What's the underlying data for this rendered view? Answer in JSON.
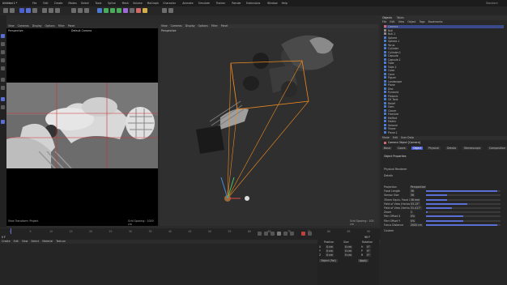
{
  "app": {
    "window_title": "Untitled 1 *",
    "menus": [
      "File",
      "Edit",
      "Create",
      "Modes",
      "Select",
      "Tools",
      "Spline",
      "Mesh",
      "Volume",
      "MoGraph",
      "Character",
      "Animate",
      "Simulate",
      "Tracker",
      "Render",
      "Extensions",
      "Window",
      "Help"
    ],
    "layout_label": "Standard"
  },
  "left_viewport": {
    "menu": [
      "View",
      "Cameras",
      "Display",
      "Options",
      "Filter",
      "Panel"
    ],
    "title": "Perspective",
    "camera": "Default Camera",
    "footer_left": "View Transform: Project",
    "footer_right": "Grid Spacing : 1000 cm"
  },
  "main_viewport": {
    "menu": [
      "View",
      "Cameras",
      "Display",
      "Options",
      "Filter",
      "Panel"
    ],
    "title": "Perspective",
    "footer_right": "Grid Spacing : 100 cm"
  },
  "timeline": {
    "frames": [
      "0",
      "5",
      "10",
      "15",
      "20",
      "25",
      "30",
      "35",
      "40",
      "45",
      "50",
      "55",
      "60",
      "65",
      "70",
      "75",
      "80",
      "85",
      "90"
    ],
    "current_frame": "0 F",
    "end_frame": "90 F"
  },
  "bottom_panel": {
    "menu": [
      "Create",
      "Edit",
      "View",
      "Select",
      "Material",
      "Texture"
    ],
    "coordinates": {
      "headers": [
        "Position",
        "Size",
        "Rotation"
      ],
      "rows": [
        [
          "X",
          "0 cm",
          "0 cm",
          "H",
          "0°"
        ],
        [
          "Y",
          "0 cm",
          "0 cm",
          "P",
          "0°"
        ],
        [
          "Z",
          "0 cm",
          "0 cm",
          "B",
          "0°"
        ]
      ],
      "mode": "Object (Rel)",
      "apply": "Apply"
    }
  },
  "object_manager": {
    "tabs": [
      "Objects",
      "Takes"
    ],
    "menu": [
      "File",
      "Edit",
      "View",
      "Object",
      "Tags",
      "Bookmarks"
    ],
    "items": [
      "Camera",
      "Null",
      "Null.1",
      "Sphere",
      "Sphere.1",
      "Torus",
      "Cylinder",
      "Cylinder.1",
      "Capsule",
      "Capsule.1",
      "Tube",
      "Tube.1",
      "Cube",
      "Cone",
      "Figure",
      "Landscape",
      "Plane",
      "Disc",
      "Pyramid",
      "Platonic",
      "Oil Tank",
      "Relief",
      "Gem",
      "Cloner",
      "Fracture",
      "MoText",
      "Matrix",
      "Voronoi",
      "Tracer",
      "Plane.1"
    ]
  },
  "attribute_manager": {
    "menu": [
      "Mode",
      "Edit",
      "User Data"
    ],
    "object_title": "Camera Object [Camera]",
    "tabs": [
      "Basic",
      "Coord.",
      "Object",
      "Physical",
      "Details",
      "Stereoscopic",
      "Composition"
    ],
    "sections": [
      "Object Properties",
      "Physical Renderer",
      "Details"
    ],
    "rows": [
      {
        "label": "Projection",
        "value": "Perspective",
        "fraction": 0
      },
      {
        "label": "Focal Length",
        "value": "36",
        "fraction": 0.96
      },
      {
        "label": "Sensor Size",
        "value": "36",
        "fraction": 0.28
      },
      {
        "label": "35mm Equiv. Focal Length",
        "value": "36 mm",
        "fraction": 0.28
      },
      {
        "label": "Field of View (Horizontal)",
        "value": "53.13°",
        "fraction": 0.55
      },
      {
        "label": "Field of View (Vertical)",
        "value": "31.417°",
        "fraction": 0.35
      },
      {
        "label": "Zoom",
        "value": "1",
        "fraction": 0.02
      },
      {
        "label": "Film Offset X",
        "value": "0%",
        "fraction": 0.5
      },
      {
        "label": "Film Offset Y",
        "value": "0%",
        "fraction": 0.5
      },
      {
        "label": "Focus Distance",
        "value": "2000 cm",
        "fraction": 0.96
      }
    ],
    "footer": "Custom"
  },
  "colors": {
    "accent": "#f08a1e",
    "selection": "#5a6fd6",
    "x_axis": "#e04848",
    "y_axis": "#4cc46a",
    "z_axis": "#4a8ae0"
  }
}
